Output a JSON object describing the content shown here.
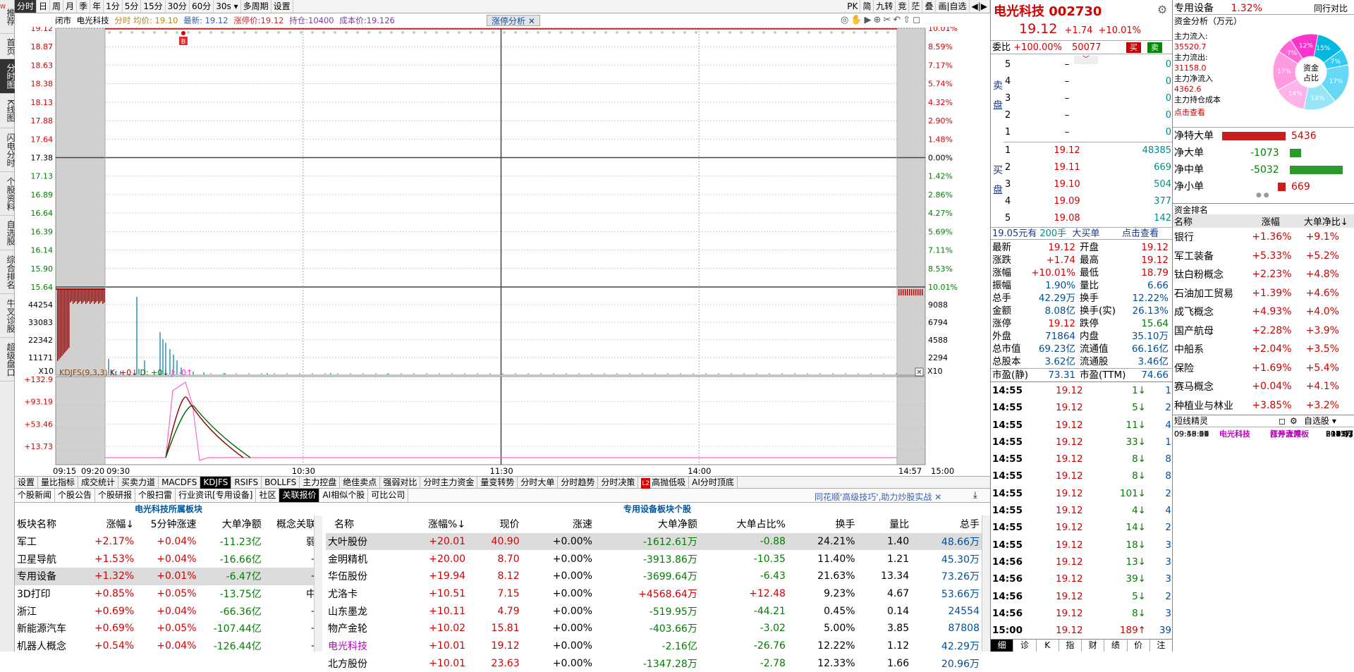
{
  "left_nav": {
    "items": [
      {
        "label": "推荐",
        "badge": "NEW"
      },
      {
        "label": "首页"
      },
      {
        "label": "分时图",
        "active": true
      },
      {
        "label": "K线图"
      },
      {
        "label": "闪电分时"
      },
      {
        "label": "个股资料"
      },
      {
        "label": "自选股"
      },
      {
        "label": "综合排名"
      },
      {
        "label": "牛叉诊股"
      },
      {
        "label": "超级盘口"
      }
    ]
  },
  "toolbar": {
    "periods": [
      "分时",
      "日",
      "周",
      "月",
      "季",
      "年",
      "1分",
      "5分",
      "15分",
      "30分",
      "60分",
      "30s ▾",
      "多周期",
      "设置"
    ],
    "right": [
      "PK",
      "简",
      "九转",
      "竞",
      "茫",
      "叠",
      "画|自选",
      "◀|▶"
    ]
  },
  "chart_header": {
    "status": "闭市",
    "name": "电光科技",
    "avg": "分时 均价: 19.10",
    "latest": "最新: 19.12",
    "limit": "涨停价:19.12",
    "hold": "持仓:10400",
    "cost": "成本价:19.126",
    "limit_btn": "涨停分析"
  },
  "price_axis": {
    "left": [
      "19.12",
      "18.87",
      "18.63",
      "18.38",
      "18.13",
      "17.88",
      "17.64",
      "17.38",
      "17.13",
      "16.89",
      "16.64",
      "16.39",
      "16.14",
      "15.90",
      "15.64"
    ],
    "right": [
      "10.01%",
      "8.59%",
      "7.17%",
      "5.74%",
      "4.32%",
      "2.90%",
      "1.48%",
      "0.00%",
      "1.42%",
      "2.86%",
      "4.27%",
      "5.69%",
      "7.11%",
      "8.53%",
      "10.01%"
    ]
  },
  "volume_axis": {
    "left": [
      "44254",
      "33083",
      "22342",
      "11171"
    ],
    "right": [
      "9088",
      "6794",
      "4588",
      "2294"
    ],
    "unit": "X10"
  },
  "kdj": {
    "label": "KDJFS(9,3,3)",
    "k": "K: +0↓",
    "d": "D: +0↓",
    "j": "J: -0↑",
    "ticks": [
      "+132.9",
      "+93.19",
      "+53.46",
      "+13.73"
    ]
  },
  "time_axis": [
    "09:15",
    "09:20",
    "09:30",
    "10:30",
    "11:30",
    "14:00",
    "14:57",
    "15:00"
  ],
  "bottom_tabs": [
    "设置",
    "量比指标",
    "成交统计",
    "买卖力道",
    "MACDFS",
    "KDJFS",
    "RSIFS",
    "BOLLFS",
    "主力控盘",
    "绝佳卖点",
    "强弱对比",
    "分时主力资金",
    "量变转势",
    "分时大单",
    "分时趋势",
    "分时决策",
    "高抛低吸",
    "AI分时顶底"
  ],
  "info_tabs": [
    "个股新闻",
    "个股公告",
    "个股研报",
    "个股扫雷",
    "行业资讯[专用设备]",
    "社区",
    "关联报价",
    "AI相似个股",
    "可比公司"
  ],
  "slogan": "同花顺'高级技巧',助力炒股实战 ✕",
  "sector_table": {
    "title": "电光科技所属板块",
    "headers": [
      "板块名称",
      "涨幅↓",
      "5分钟涨速",
      "大单净额",
      "概念关联"
    ],
    "rows": [
      [
        "军工",
        "+2.17%",
        "+0.04%",
        "-11.23亿",
        "弱"
      ],
      [
        "卫星导航",
        "+1.53%",
        "+0.04%",
        "-16.66亿",
        "–"
      ],
      [
        "专用设备",
        "+1.32%",
        "+0.01%",
        "-6.47亿",
        "–"
      ],
      [
        "3D打印",
        "+0.85%",
        "+0.05%",
        "-13.75亿",
        "中"
      ],
      [
        "浙江",
        "+0.69%",
        "+0.04%",
        "-66.36亿",
        "–"
      ],
      [
        "新能源汽车",
        "+0.69%",
        "+0.05%",
        "-107.44亿",
        "–"
      ],
      [
        "机器人概念",
        "+0.54%",
        "+0.04%",
        "-126.44亿",
        "–"
      ]
    ]
  },
  "peer_table": {
    "title": "专用设备板块个股",
    "headers": [
      "名称",
      "涨幅%↓",
      "现价",
      "涨速",
      "大单净额",
      "大单占比%",
      "换手",
      "量比",
      "总手"
    ],
    "rows": [
      [
        "大叶股份",
        "+20.01",
        "40.90",
        "+0.00%",
        "-1612.61万",
        "-0.88",
        "24.21%",
        "1.40",
        "48.66万"
      ],
      [
        "金明精机",
        "+20.00",
        "8.70",
        "+0.00%",
        "-3913.86万",
        "-10.35",
        "11.40%",
        "1.21",
        "45.30万"
      ],
      [
        "华伍股份",
        "+19.94",
        "8.12",
        "+0.00%",
        "-3699.64万",
        "-6.43",
        "21.63%",
        "13.34",
        "73.26万"
      ],
      [
        "尤洛卡",
        "+10.51",
        "7.15",
        "+0.00%",
        "+4568.64万",
        "+12.48",
        "9.23%",
        "4.67",
        "53.66万"
      ],
      [
        "山东墨龙",
        "+10.11",
        "4.79",
        "+0.00%",
        "-519.95万",
        "-44.21",
        "0.45%",
        "0.14",
        "24554"
      ],
      [
        "物产金轮",
        "+10.02",
        "15.81",
        "+0.00%",
        "-403.66万",
        "-3.02",
        "5.00%",
        "3.85",
        "87808"
      ],
      [
        "电光科技",
        "+10.01",
        "19.12",
        "+0.00%",
        "-2.16亿",
        "-26.76",
        "12.22%",
        "1.12",
        "42.29万"
      ],
      [
        "北方股份",
        "+10.01",
        "23.63",
        "+0.00%",
        "-1347.28万",
        "-2.78",
        "12.33%",
        "1.66",
        "20.96万"
      ]
    ]
  },
  "quote": {
    "name": "电光科技",
    "code": "002730",
    "price": "19.12",
    "change": "+1.74",
    "pct": "+10.01%",
    "weibi_label": "委比",
    "weibi": "+100.00%",
    "weicha": "50077",
    "buy": "买",
    "sell": "卖",
    "sell_levels": [
      [
        "5",
        "–",
        "0"
      ],
      [
        "4",
        "–",
        "0"
      ],
      [
        "3",
        "–",
        "0"
      ],
      [
        "2",
        "–",
        "0"
      ],
      [
        "1",
        "–",
        "0"
      ]
    ],
    "buy_levels": [
      [
        "1",
        "19.12",
        "48385"
      ],
      [
        "2",
        "19.11",
        "669"
      ],
      [
        "3",
        "19.10",
        "504"
      ],
      [
        "4",
        "19.09",
        "377"
      ],
      [
        "5",
        "19.08",
        "142"
      ]
    ],
    "sell_side": "卖盘",
    "buy_side": "买盘",
    "bigorder": "19.05元有",
    "bigorder_qty": "200手",
    "bigorder_type": "大买单",
    "bigorder_link": "点击查看",
    "stats": [
      [
        "最新",
        "19.12",
        "开盘",
        "19.12"
      ],
      [
        "涨跌",
        "+1.74",
        "最高",
        "19.12"
      ],
      [
        "涨幅",
        "+10.01%",
        "最低",
        "18.79"
      ],
      [
        "振幅",
        "1.90%",
        "量比",
        "6.66"
      ],
      [
        "总手",
        "42.29万",
        "换手",
        "12.22%"
      ],
      [
        "金额",
        "8.08亿",
        "换手(实)",
        "26.13%"
      ],
      [
        "涨停",
        "19.12",
        "跌停",
        "15.64"
      ],
      [
        "外盘",
        "71864",
        "内盘",
        "35.10万"
      ],
      [
        "总市值",
        "69.23亿",
        "流通值",
        "66.16亿"
      ],
      [
        "总股本",
        "3.62亿",
        "流通股",
        "3.46亿"
      ],
      [
        "市盈(静)",
        "73.31",
        "市盈(TTM)",
        "74.66"
      ]
    ],
    "ticks": [
      [
        "14:55",
        "19.12",
        "1↓",
        "1"
      ],
      [
        "14:55",
        "19.12",
        "5↓",
        "2"
      ],
      [
        "14:55",
        "19.12",
        "11↓",
        "4"
      ],
      [
        "14:55",
        "19.12",
        "33↓",
        "1"
      ],
      [
        "14:55",
        "19.12",
        "8↓",
        "8"
      ],
      [
        "14:55",
        "19.12",
        "8↓",
        "8"
      ],
      [
        "14:55",
        "19.12",
        "101↓",
        "2"
      ],
      [
        "14:55",
        "19.12",
        "4↓",
        "4"
      ],
      [
        "14:55",
        "19.12",
        "14↓",
        "2"
      ],
      [
        "14:55",
        "19.12",
        "18↓",
        "3"
      ],
      [
        "14:56",
        "19.12",
        "13↓",
        "3"
      ],
      [
        "14:56",
        "19.12",
        "39↓",
        "3"
      ],
      [
        "14:56",
        "19.12",
        "5↓",
        "2"
      ],
      [
        "14:56",
        "19.12",
        "8↓",
        "3"
      ],
      [
        "15:00",
        "19.12",
        "189↑",
        "39"
      ]
    ],
    "bottom_icons": [
      "细",
      "诊",
      "K",
      "指",
      "财",
      "绩",
      "价",
      "注"
    ]
  },
  "sector_panel": {
    "title": "专用设备",
    "pct": "1.32%",
    "compare": "同行对比",
    "flow_title": "资金分析（万元）",
    "flow": [
      [
        "主力流入:",
        "35520.7"
      ],
      [
        "主力流出:",
        "31158.0"
      ],
      [
        "主力净流入",
        "4362.6"
      ],
      [
        "主力持仓成本",
        ""
      ]
    ],
    "flow_link": "点击查看",
    "donut_center": "资金\n占比",
    "donut_labels": [
      "12%",
      "15%",
      "7%",
      "7%",
      "17%",
      "17%",
      "14%",
      "14%"
    ],
    "net": [
      [
        "净特大单",
        "5436",
        1
      ],
      [
        "净大单",
        "-1073",
        -1
      ],
      [
        "净中单",
        "-5032",
        -1
      ],
      [
        "净小单",
        "669",
        1
      ]
    ],
    "rank_title": "资金排名",
    "rank_headers": [
      "名称",
      "涨幅",
      "大单净比↓"
    ],
    "rank": [
      [
        "银行",
        "+1.36%",
        "+9.1%"
      ],
      [
        "军工装备",
        "+5.33%",
        "+5.2%"
      ],
      [
        "钛白粉概念",
        "+2.23%",
        "+4.8%"
      ],
      [
        "石油加工贸易",
        "+1.39%",
        "+4.6%"
      ],
      [
        "成飞概念",
        "+4.93%",
        "+4.0%"
      ],
      [
        "国产航母",
        "+2.28%",
        "+3.9%"
      ],
      [
        "中船系",
        "+2.04%",
        "+3.5%"
      ],
      [
        "保险",
        "+1.69%",
        "+5.4%"
      ],
      [
        "赛马概念",
        "+0.04%",
        "+4.1%"
      ],
      [
        "种植业与林业",
        "+3.85%",
        "+3.2%"
      ]
    ],
    "sprite_title": "短线精灵",
    "sprite_select": "自选股",
    "sprite": [
      [
        "09:40:00",
        "电光科技",
        "涨停大减",
        "6913万"
      ],
      [
        "09:40:12",
        "电光科技",
        "打开涨停板",
        "18.97"
      ],
      [
        "09:45:06",
        "电光科技",
        "涨停大减",
        "8041万"
      ],
      [
        "09:45:30",
        "电光科技",
        "打开涨停板",
        "18.93"
      ],
      [
        "09:45:57",
        "电光科技",
        "打开涨停板",
        "19.11"
      ],
      [
        "09:46:54",
        "电光科技",
        "打开涨停板",
        "19.12"
      ],
      [
        "09:48:06",
        "电光科技",
        "打开涨停板",
        "19.12"
      ],
      [
        "09:48:54",
        "电光科技",
        "打开涨停板",
        "19.12"
      ],
      [
        "09:49:39",
        "电光科技",
        "涨停大减",
        "2975万"
      ],
      [
        "09:50:21",
        "电光科技",
        "打开涨停板",
        "19.12"
      ],
      [
        "09:56:39",
        "电光科技",
        "涨停大减",
        "2187万"
      ]
    ]
  },
  "colors": {
    "up": "#d40000",
    "down": "#008000",
    "vol_red": "#c00000",
    "vol_teal": "#1a8fa8",
    "kdj_k": "#8b0000",
    "kdj_d": "#006400",
    "kdj_j": "#ff66cc"
  }
}
